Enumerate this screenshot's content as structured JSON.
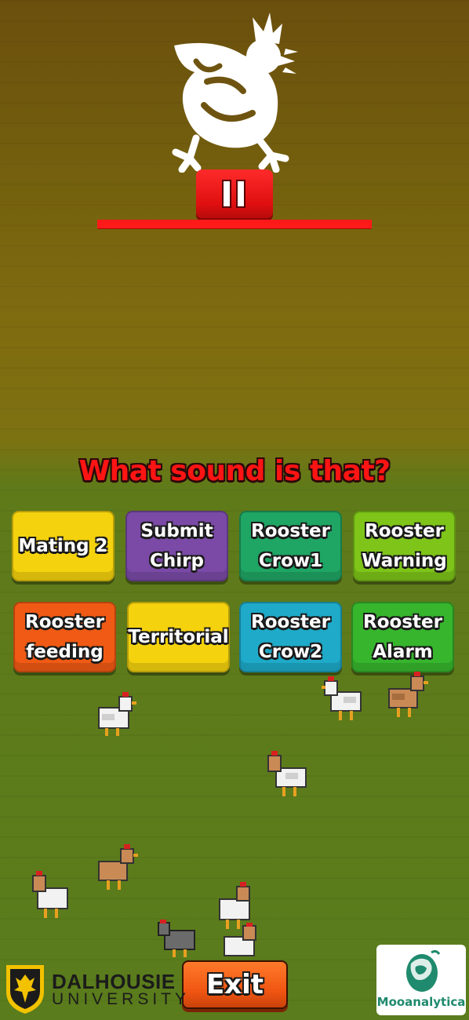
{
  "player": {
    "icon": "rooster-icon",
    "pause_icon": "pause-icon",
    "progress_fraction": 1.0,
    "accent_color": "#ff1a1a"
  },
  "quiz": {
    "question": "What sound is that?",
    "options": [
      {
        "label": "Mating 2",
        "color": "#f4d20e"
      },
      {
        "label": "Submit\nChirp",
        "color": "#7a4aa6"
      },
      {
        "label": "Rooster\nCrow1",
        "color": "#1fa564"
      },
      {
        "label": "Rooster\nWarning",
        "color": "#7ec419"
      },
      {
        "label": "Rooster\nfeeding",
        "color": "#f05a14"
      },
      {
        "label": "Territorial",
        "color": "#f4d20e"
      },
      {
        "label": "Rooster\nCrow2",
        "color": "#1eaac8"
      },
      {
        "label": "Rooster\nAlarm",
        "color": "#36b52d"
      }
    ]
  },
  "footer": {
    "exit_label": "Exit",
    "logo_left": {
      "line1": "DALHOUSIE",
      "line2": "UNIVERSITY"
    },
    "logo_right": {
      "text": "Mooanalytica"
    }
  }
}
